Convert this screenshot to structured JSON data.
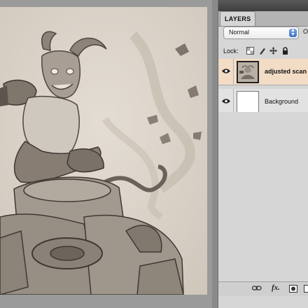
{
  "layers_panel": {
    "tab_label": "LAYERS",
    "blend_mode": "Normal",
    "opacity_label": "O",
    "lock_label": "Lock:",
    "lock_icons": [
      "lock-transparent-pixels-icon",
      "lock-image-pixels-icon",
      "lock-position-icon",
      "lock-all-icon"
    ],
    "layers": [
      {
        "name": "adjusted scan",
        "visible": true,
        "selected": true
      },
      {
        "name": "Background",
        "visible": true,
        "selected": false
      }
    ],
    "bottom_icons": [
      "link-layers-icon",
      "layer-style-icon",
      "layer-mask-icon"
    ]
  },
  "canvas": {
    "content": "sketch-artwork"
  }
}
